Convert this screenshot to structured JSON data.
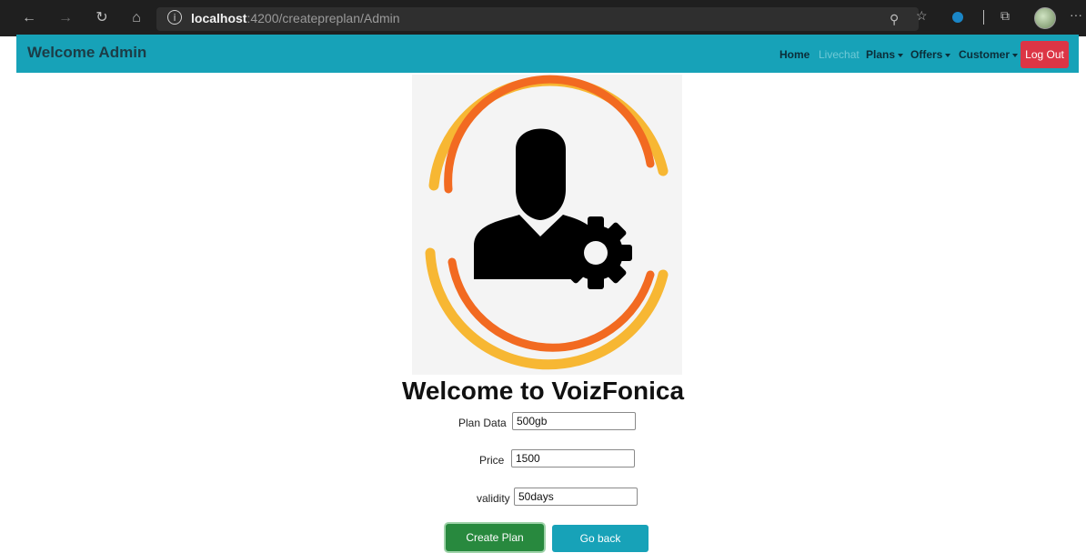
{
  "browser": {
    "url_host": "localhost",
    "url_path": ":4200/createpreplan/Admin"
  },
  "navbar": {
    "brand": "Welcome Admin",
    "links": [
      {
        "label": "Home"
      },
      {
        "label": "Livechat"
      },
      {
        "label": "Plans"
      },
      {
        "label": "Offers"
      },
      {
        "label": "Customer"
      }
    ],
    "logout_label": "Log Out"
  },
  "page": {
    "title": "Welcome to VoizFonica"
  },
  "form": {
    "plan_data": {
      "label": "Plan Data",
      "value": "500gb"
    },
    "price": {
      "label": "Price",
      "value": "1500"
    },
    "validity": {
      "label": "validity",
      "value": "50days"
    }
  },
  "buttons": {
    "create": "Create Plan",
    "back": "Go back"
  },
  "colors": {
    "navbar": "#17a2b8",
    "logout": "#dc3545",
    "create": "#28893e",
    "ring_orange": "#f26a21",
    "ring_yellow": "#f7b733"
  }
}
